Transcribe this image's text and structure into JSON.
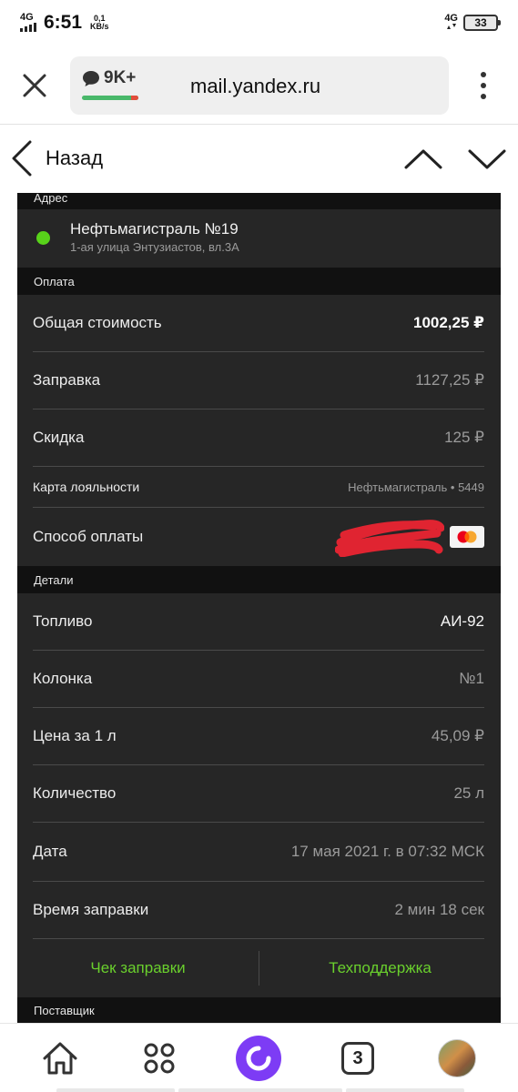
{
  "status_bar": {
    "network": "4G",
    "time": "6:51",
    "speed_value": "0,1",
    "speed_unit": "KB/s",
    "network_right": "4G",
    "battery": "33"
  },
  "browser": {
    "mail_count": "9K+",
    "url": "mail.yandex.ru"
  },
  "nav": {
    "back_label": "Назад"
  },
  "address": {
    "section_title": "Адрес",
    "station_name": "Нефтьмагистраль №19",
    "station_address": "1-ая улица Энтузиастов, вл.3А"
  },
  "payment": {
    "section_title": "Оплата",
    "rows": [
      {
        "label": "Общая стоимость",
        "value": "1002,25 ₽"
      },
      {
        "label": "Заправка",
        "value": "1127,25 ₽"
      },
      {
        "label": "Скидка",
        "value": "125 ₽"
      },
      {
        "label": "Карта лояльности",
        "value": "Нефтьмагистраль • 5449"
      },
      {
        "label": "Способ оплаты",
        "value": ""
      }
    ]
  },
  "details": {
    "section_title": "Детали",
    "rows": [
      {
        "label": "Топливо",
        "value": "АИ-92"
      },
      {
        "label": "Колонка",
        "value": "№1"
      },
      {
        "label": "Цена за 1 л",
        "value": "45,09 ₽"
      },
      {
        "label": "Количество",
        "value": "25 л"
      },
      {
        "label": "Дата",
        "value": "17 мая 2021 г. в 07:32 МСК"
      },
      {
        "label": "Время заправки",
        "value": "2 мин 18 сек"
      }
    ],
    "receipt_button": "Чек заправки",
    "support_button": "Техподдержка"
  },
  "supplier": {
    "section_title": "Поставщик"
  },
  "bottom_bar": {
    "tabs_count": "3"
  },
  "colors": {
    "accent_green": "#6ad02d",
    "status_dot": "#58d31a",
    "card_bg": "#262626",
    "alice_purple": "#7d3cf5"
  }
}
